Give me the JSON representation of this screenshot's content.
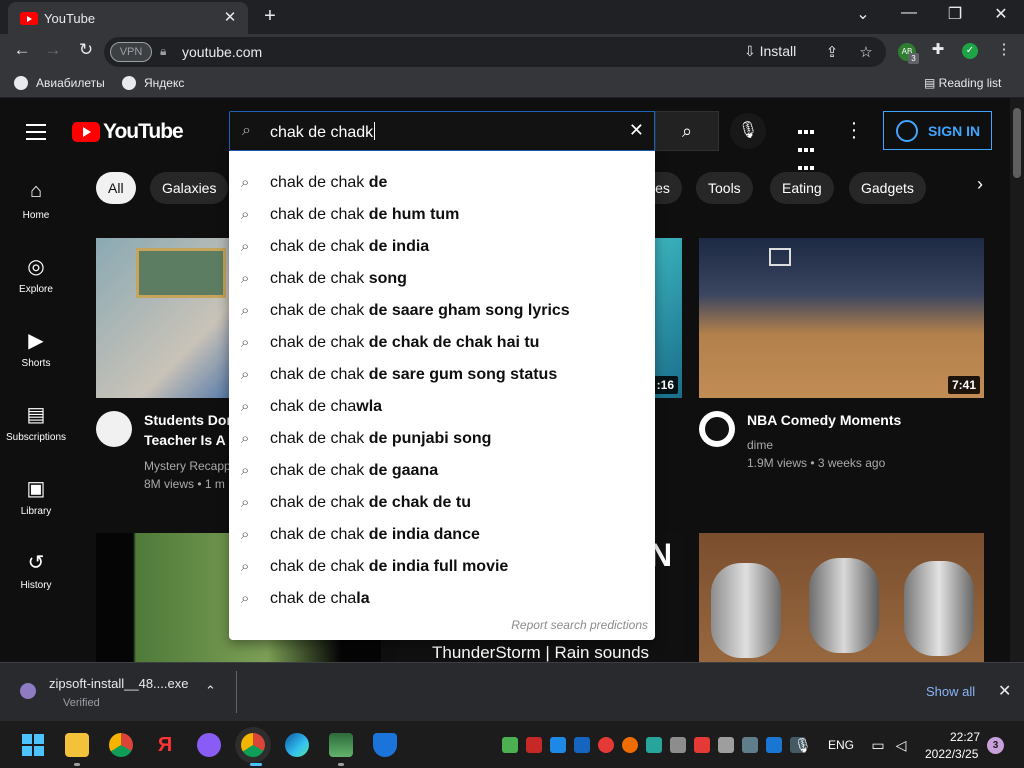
{
  "browser": {
    "tab_title": "YouTube",
    "tab_close": "✕",
    "new_tab": "+",
    "window_controls": {
      "dropdown": "⌄",
      "minimize": "—",
      "restore": "❐",
      "close": "✕"
    },
    "vpn_label": "VPN",
    "url": "youtube.com",
    "install_label": "Install",
    "extension_badge": "AB",
    "extension_badge_count": "3",
    "reading_list": "Reading list",
    "bookmarks": [
      "Авиабилеты",
      "Яндекс"
    ]
  },
  "youtube": {
    "logo_text": "YouTube",
    "search_query": "chak de chadk",
    "signin_label": "SIGN IN",
    "rail": [
      {
        "icon": "home-icon",
        "glyph": "⌂",
        "label": "Home"
      },
      {
        "icon": "explore-icon",
        "glyph": "◎",
        "label": "Explore"
      },
      {
        "icon": "shorts-icon",
        "glyph": "▶",
        "label": "Shorts"
      },
      {
        "icon": "subscriptions-icon",
        "glyph": "▤",
        "label": "Subscriptions"
      },
      {
        "icon": "library-icon",
        "glyph": "▣",
        "label": "Library"
      },
      {
        "icon": "history-icon",
        "glyph": "↺",
        "label": "History"
      }
    ],
    "chips": [
      "All",
      "Galaxies",
      "ies",
      "Tools",
      "Eating",
      "Gadgets"
    ],
    "suggestions": [
      {
        "base": "chak de chak",
        "rest": " de"
      },
      {
        "base": "chak de chak",
        "rest": " de hum tum"
      },
      {
        "base": "chak de chak",
        "rest": " de india"
      },
      {
        "base": "chak de chak",
        "rest": " song"
      },
      {
        "base": "chak de chak",
        "rest": " de saare gham song lyrics"
      },
      {
        "base": "chak de chak",
        "rest": " de chak de chak hai tu"
      },
      {
        "base": "chak de chak",
        "rest": " de sare gum song status"
      },
      {
        "base": "chak de cha",
        "rest": "wla"
      },
      {
        "base": "chak de chak",
        "rest": " de punjabi song"
      },
      {
        "base": "chak de chak",
        "rest": " de gaana"
      },
      {
        "base": "chak de chak",
        "rest": " de chak de tu"
      },
      {
        "base": "chak de chak",
        "rest": " de india dance"
      },
      {
        "base": "chak de chak",
        "rest": " de india full movie"
      },
      {
        "base": "chak de cha",
        "rest": "la"
      }
    ],
    "report_label": "Report search predictions",
    "videos": [
      {
        "title_line1": "Students Don'",
        "title_line2": "Teacher Is A K",
        "channel": "Mystery Recapp",
        "meta": "8M views • 1 m",
        "duration": ""
      },
      {
        "title_line1": "",
        "title_line2": "",
        "channel": "",
        "meta": "",
        "duration": ":16"
      },
      {
        "title_line1": "NBA Comedy Moments",
        "title_line2": "",
        "channel": "dime",
        "meta": "1.9M views • 3 weeks ago",
        "duration": "7:41"
      }
    ],
    "thumb_overlay_text": "ThunderStorm | Rain sounds",
    "thumb_overlay_letter": "N"
  },
  "download": {
    "filename": "zipsoft-install__48....exe",
    "status": "Verified",
    "show_all": "Show all"
  },
  "taskbar": {
    "lang": "ENG",
    "time": "22:27",
    "date": "2022/3/25",
    "notifications": "3"
  }
}
